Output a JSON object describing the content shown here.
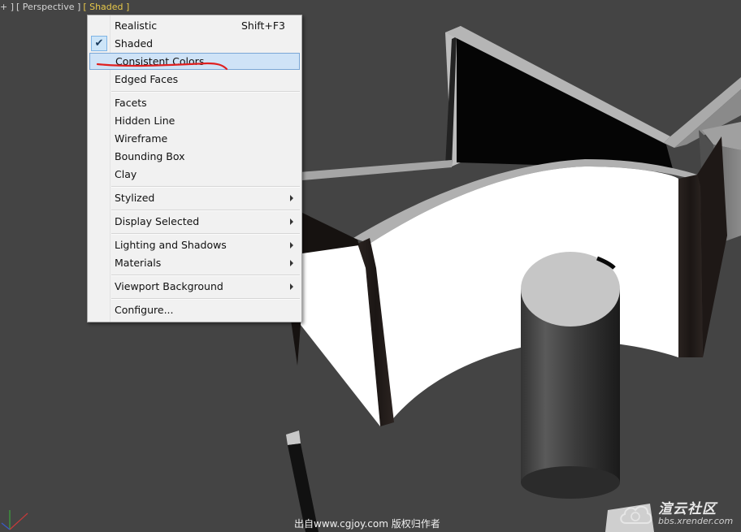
{
  "viewport": {
    "labels": [
      "+ ]",
      "[ Perspective ]",
      "[ Shaded ]"
    ]
  },
  "menu": {
    "items": [
      {
        "label": "Realistic",
        "shortcut": "Shift+F3"
      },
      {
        "label": "Shaded",
        "checked": true
      },
      {
        "label": "Consistent Colors",
        "highlighted": true
      },
      {
        "label": "Edged Faces"
      },
      {
        "label": "Facets"
      },
      {
        "label": "Hidden Line"
      },
      {
        "label": "Wireframe"
      },
      {
        "label": "Bounding Box"
      },
      {
        "label": "Clay"
      },
      {
        "label": "Stylized",
        "submenu": true
      },
      {
        "label": "Display Selected",
        "submenu": true
      },
      {
        "label": "Lighting and Shadows",
        "submenu": true
      },
      {
        "label": "Materials",
        "submenu": true
      },
      {
        "label": "Viewport Background",
        "submenu": true
      },
      {
        "label": "Configure..."
      }
    ]
  },
  "watermark": {
    "text": "出自www.cgjoy.com 版权归作者"
  },
  "logo": {
    "name": "渲云社区",
    "url": "bbs.xrender.com"
  },
  "colors": {
    "viewport_bg": "#444444",
    "label_highlight": "#e7c84a",
    "menu_bg": "#f1f1f1",
    "menu_highlight": "#cfe3f7",
    "annotation": "#e02020"
  }
}
